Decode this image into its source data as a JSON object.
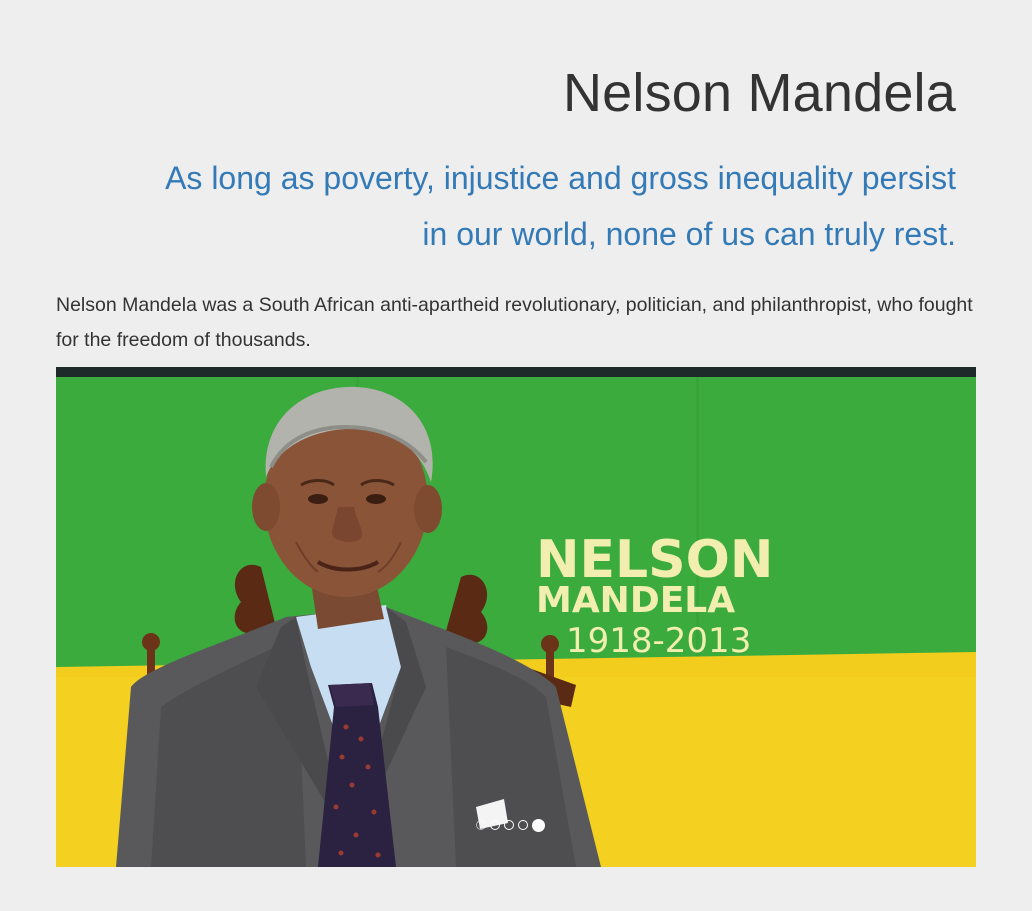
{
  "header": {
    "title": "Nelson Mandela",
    "quote_line_1": "As long as poverty, injustice and gross inequality persist",
    "quote_line_2": "in our world, none of us can truly rest."
  },
  "intro": {
    "description": "Nelson Mandela was a South African anti-apartheid revolutionary, politician, and philanthropist, who fought for the freedom of thousands."
  },
  "carousel": {
    "slide_alt": "Nelson Mandela",
    "banner_name_1": "NELSON",
    "banner_name_2": "MANDELA",
    "banner_years": "1918-2013",
    "indicator_count": 5,
    "active_index": 4,
    "colors": {
      "banner_green": "#3cab3e",
      "banner_yellow": "#f7d21c",
      "banner_text": "#f2eeb0"
    }
  },
  "theme": {
    "background": "#eeeeee",
    "title_color": "#333333",
    "quote_color": "#337ab7"
  }
}
